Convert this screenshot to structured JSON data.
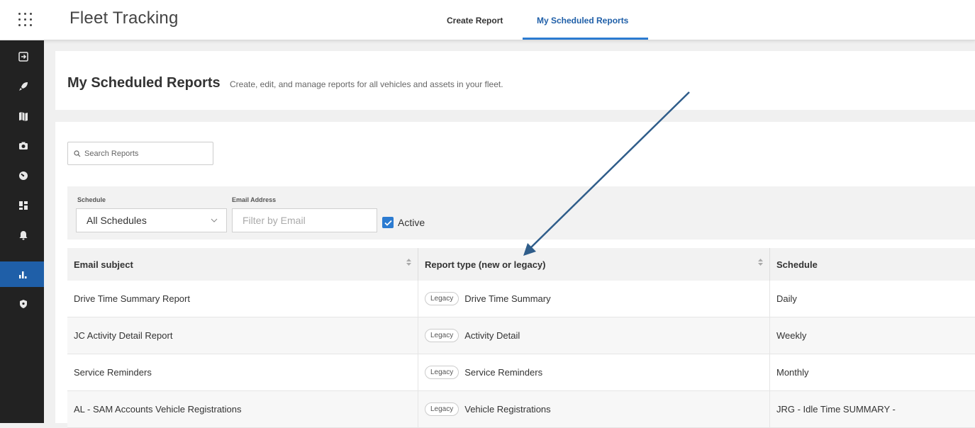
{
  "app": {
    "title": "Fleet Tracking"
  },
  "tabs": [
    {
      "label": "Create Report",
      "active": false
    },
    {
      "label": "My Scheduled Reports",
      "active": true
    }
  ],
  "sidebar": {
    "items": [
      {
        "icon": "exit-icon",
        "active": false
      },
      {
        "icon": "rocket-icon",
        "active": false
      },
      {
        "icon": "map-icon",
        "active": false
      },
      {
        "icon": "camera-icon",
        "active": false
      },
      {
        "icon": "gauge-icon",
        "active": false
      },
      {
        "icon": "dashboard-icon",
        "active": false
      },
      {
        "icon": "bell-icon",
        "active": false
      },
      {
        "icon": "bar-chart-icon",
        "active": true
      },
      {
        "icon": "shield-icon",
        "active": false
      }
    ]
  },
  "page": {
    "title": "My Scheduled Reports",
    "subtitle": "Create, edit, and manage reports for all vehicles and assets in your fleet."
  },
  "search": {
    "placeholder": "Search Reports"
  },
  "filters": {
    "schedule_label": "Schedule",
    "schedule_value": "All Schedules",
    "email_label": "Email Address",
    "email_placeholder": "Filter by Email",
    "active_label": "Active",
    "active_checked": true
  },
  "table": {
    "columns": [
      "Email subject",
      "Report type (new or legacy)",
      "Schedule"
    ],
    "rows": [
      {
        "subject": "Drive Time Summary Report",
        "badge": "Legacy",
        "type": "Drive Time Summary",
        "schedule": "Daily"
      },
      {
        "subject": "JC Activity Detail Report",
        "badge": "Legacy",
        "type": "Activity Detail",
        "schedule": "Weekly"
      },
      {
        "subject": "Service Reminders",
        "badge": "Legacy",
        "type": "Service Reminders",
        "schedule": "Monthly"
      },
      {
        "subject": "AL - SAM Accounts Vehicle Registrations",
        "badge": "Legacy",
        "type": "Vehicle Registrations",
        "schedule": "JRG - Idle Time SUMMARY -"
      }
    ]
  },
  "colors": {
    "accent": "#2b7bd1",
    "sidebar": "#222222",
    "active_nav": "#1f5fa8",
    "arrow": "#2f5d8a"
  }
}
